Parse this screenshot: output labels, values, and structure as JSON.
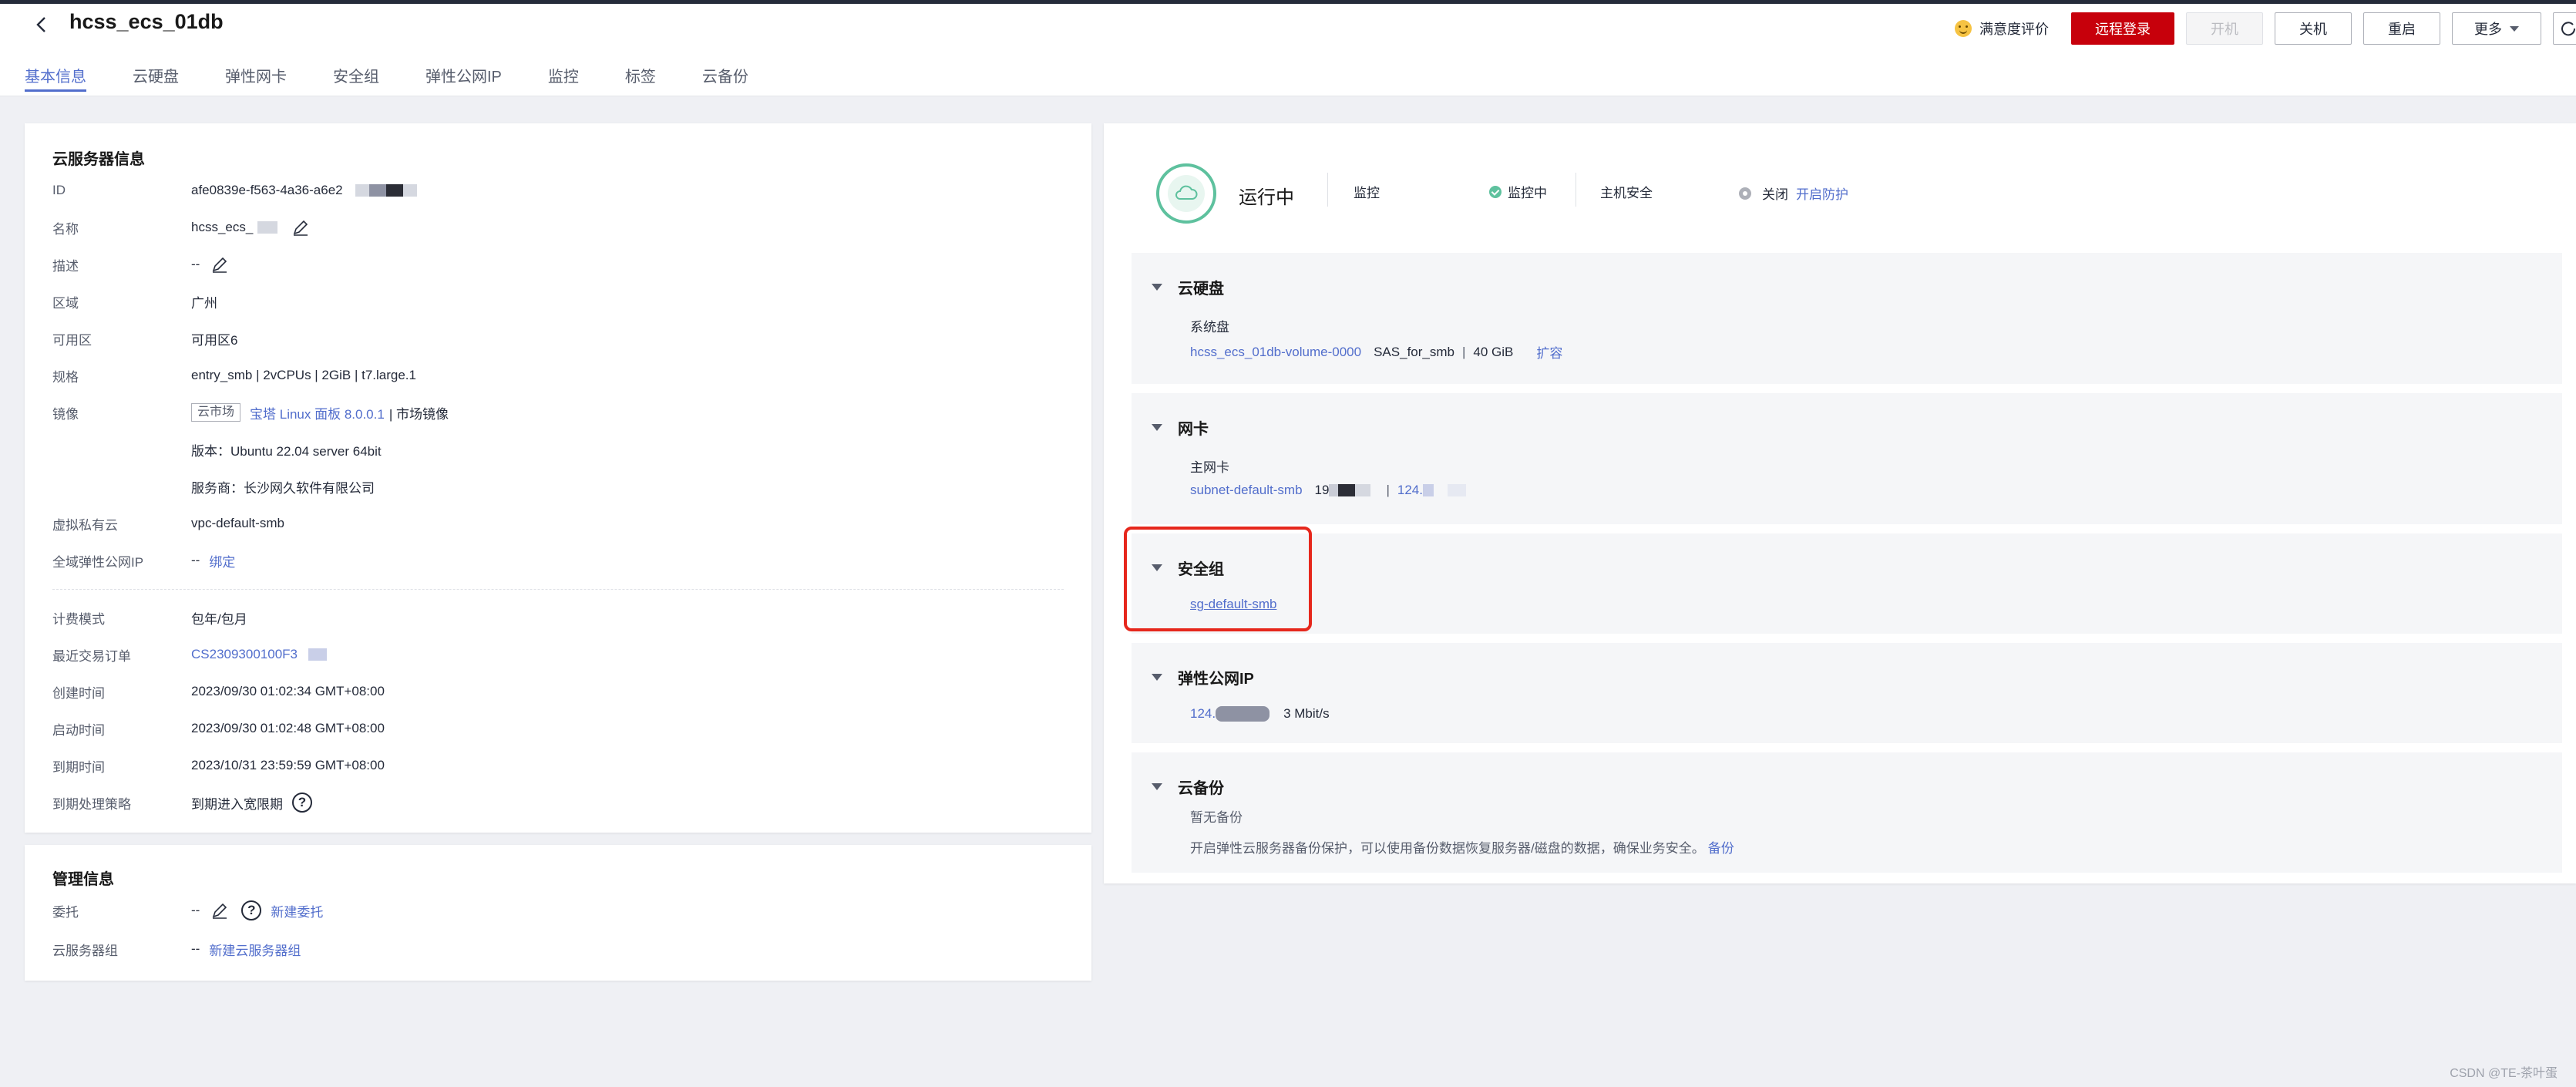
{
  "header": {
    "title": "hcss_ecs_01db",
    "feedback": "满意度评价",
    "buttons": {
      "remote_login": "远程登录",
      "start": "开机",
      "shutdown": "关机",
      "restart": "重启",
      "more": "更多"
    }
  },
  "tabs": [
    "基本信息",
    "云硬盘",
    "弹性网卡",
    "安全组",
    "弹性公网IP",
    "监控",
    "标签",
    "云备份"
  ],
  "server_info": {
    "title": "云服务器信息",
    "id": {
      "label": "ID",
      "value": "afe0839e-f563-4a36-a6e2"
    },
    "name": {
      "label": "名称",
      "value": "hcss_ecs_"
    },
    "desc": {
      "label": "描述",
      "value": "--"
    },
    "region": {
      "label": "区域",
      "value": "广州"
    },
    "az": {
      "label": "可用区",
      "value": "可用区6"
    },
    "spec": {
      "label": "规格",
      "value": "entry_smb | 2vCPUs | 2GiB | t7.large.1"
    },
    "image": {
      "label": "镜像",
      "tag": "云市场",
      "link": "宝塔 Linux 面板 8.0.0.1",
      "suffix": "| 市场镜像",
      "version": "版本：Ubuntu 22.04 server 64bit",
      "vendor": "服务商：长沙网久软件有限公司"
    },
    "vpc": {
      "label": "虚拟私有云",
      "value": "vpc-default-smb"
    },
    "global_eip": {
      "label": "全域弹性公网IP",
      "value": "--",
      "link": "绑定"
    },
    "billing": {
      "label": "计费模式",
      "value": "包年/包月"
    },
    "order": {
      "label": "最近交易订单",
      "value": "CS2309300100F3"
    },
    "created": {
      "label": "创建时间",
      "value": "2023/09/30 01:02:34 GMT+08:00"
    },
    "started": {
      "label": "启动时间",
      "value": "2023/09/30 01:02:48 GMT+08:00"
    },
    "expires": {
      "label": "到期时间",
      "value": "2023/10/31 23:59:59 GMT+08:00"
    },
    "expiry_policy": {
      "label": "到期处理策略",
      "value": "到期进入宽限期"
    }
  },
  "management": {
    "title": "管理信息",
    "agency": {
      "label": "委托",
      "value": "--",
      "link": "新建委托"
    },
    "group": {
      "label": "云服务器组",
      "value": "--",
      "link": "新建云服务器组"
    }
  },
  "status": {
    "state": "运行中",
    "monitor_label": "监控",
    "monitor_value": "监控中",
    "host_security_label": "主机安全",
    "host_security_value": "关闭",
    "host_security_link": "开启防护"
  },
  "disk": {
    "title": "云硬盘",
    "system_label": "系统盘",
    "volume_link": "hcss_ecs_01db-volume-0000",
    "type": "SAS_for_smb",
    "size": "40 GiB",
    "expand": "扩容"
  },
  "nic": {
    "title": "网卡",
    "primary_label": "主网卡",
    "subnet_link": "subnet-default-smb",
    "ip_prefix": "19",
    "eip_prefix": "124."
  },
  "security_group": {
    "title": "安全组",
    "link": "sg-default-smb"
  },
  "eip": {
    "title": "弹性公网IP",
    "ip_prefix": "124.",
    "bandwidth": "3 Mbit/s"
  },
  "backup": {
    "title": "云备份",
    "none": "暂无备份",
    "desc": "开启弹性云服务器备份保护，可以使用备份数据恢复服务器/磁盘的数据，确保业务安全。",
    "link": "备份"
  },
  "watermark": "CSDN @TE-茶叶蛋",
  "colors": {
    "accent": "#526ecc",
    "primary_button": "#c7000b",
    "running": "#5ec19e",
    "highlight_box": "#e6271c"
  }
}
